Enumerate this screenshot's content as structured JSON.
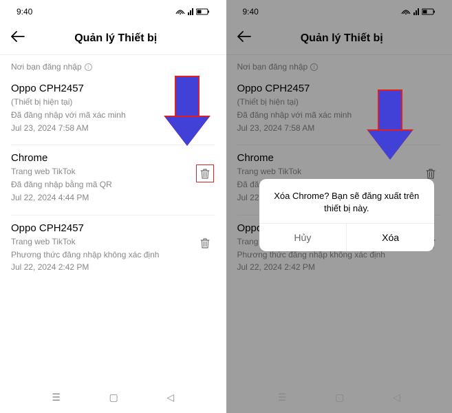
{
  "status": {
    "time": "9:40"
  },
  "header": {
    "title": "Quản lý Thiết bị"
  },
  "section_label": "Nơi bạn đăng nhập",
  "devices": [
    {
      "name": "Oppo CPH2457",
      "sub": "(Thiết bị hiện tại)",
      "method": "Đã đăng nhập với mã xác minh",
      "date": "Jul 23, 2024 7:58 AM"
    },
    {
      "name": "Chrome",
      "sub": "Trang web TikTok",
      "method": "Đã đăng nhập bằng mã QR",
      "date": "Jul 22, 2024 4:44 PM"
    },
    {
      "name": "Oppo CPH2457",
      "sub": "Trang web TikTok",
      "method": "Phương thức đăng nhập không xác định",
      "date": "Jul 22, 2024 2:42 PM"
    }
  ],
  "dialog": {
    "message": "Xóa Chrome? Bạn sẽ đăng xuất trên thiết bị này.",
    "cancel": "Hủy",
    "confirm": "Xóa"
  }
}
